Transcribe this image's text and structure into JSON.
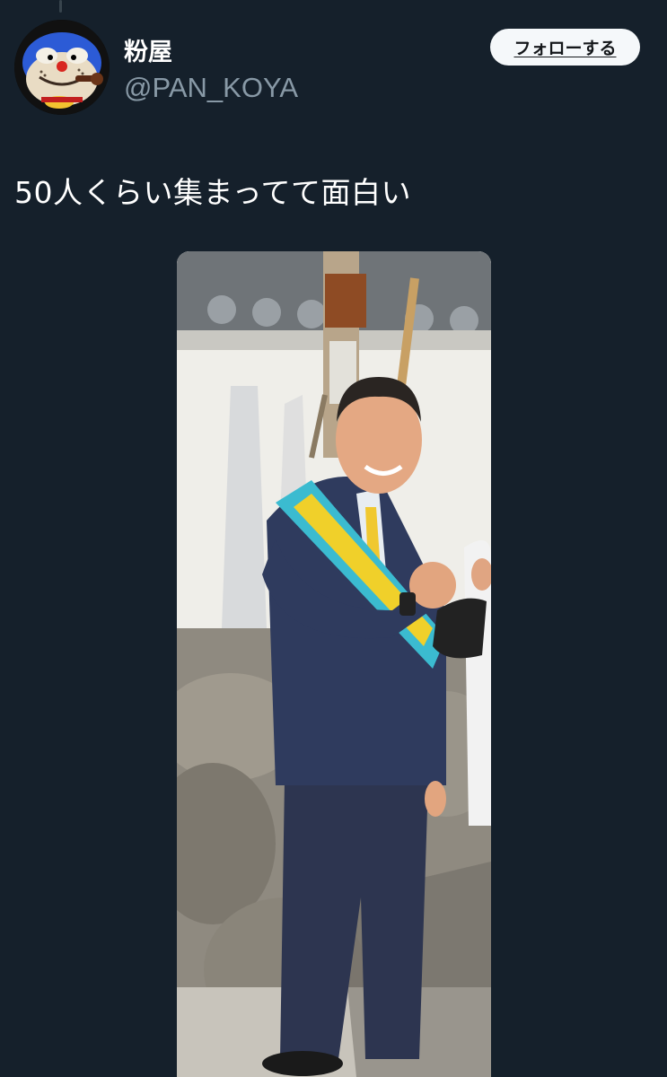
{
  "tweet": {
    "author": {
      "display_name": "粉屋",
      "handle": "@PAN_KOYA",
      "avatar_icon": "cartoon-cat-avatar"
    },
    "follow_label": "フォローする",
    "text": "50人くらい集まってて面白い",
    "media_icon": "photo-man-in-suit-with-sash"
  },
  "colors": {
    "background": "#15202b",
    "secondary_text": "#8899a6",
    "button_bg": "#f5f8fa"
  }
}
